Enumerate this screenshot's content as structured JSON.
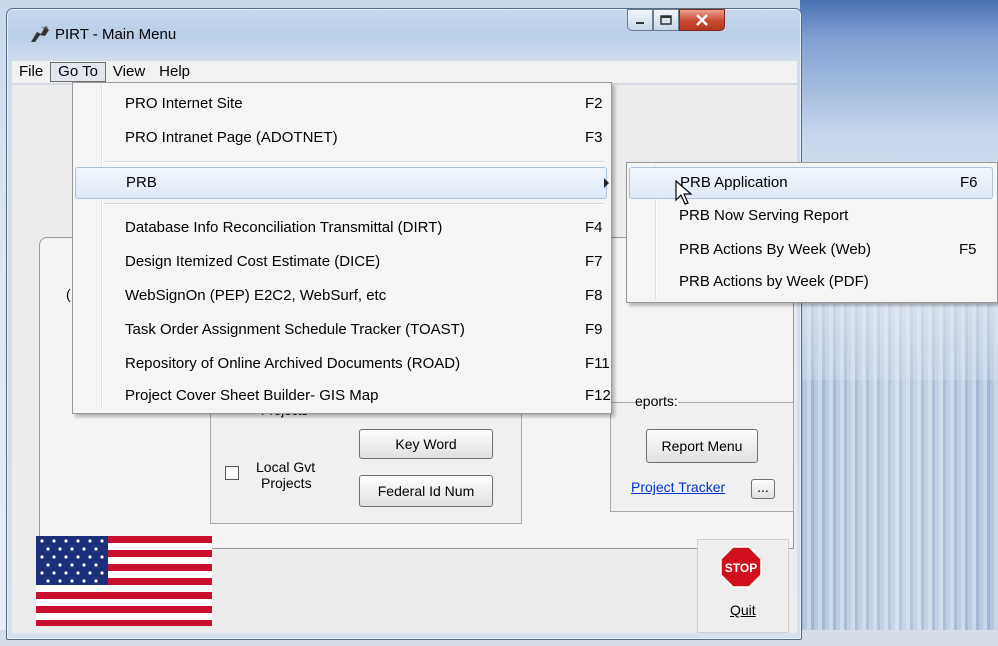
{
  "window": {
    "title": "PIRT - Main Menu",
    "icon": "pirt-app-icon"
  },
  "menubar": {
    "items": [
      "File",
      "Go To",
      "View",
      "Help"
    ],
    "active": "Go To"
  },
  "goto_menu": {
    "items": [
      {
        "label": "PRO Internet Site",
        "key": "F2"
      },
      {
        "label": "PRO Intranet Page (ADOTNET)",
        "key": "F3"
      },
      {
        "label": "PRB",
        "key": ""
      },
      {
        "label": "Database Info Reconciliation Transmittal (DIRT)",
        "key": "F4"
      },
      {
        "label": "Design Itemized Cost Estimate (DICE)",
        "key": "F7"
      },
      {
        "label": "WebSignOn (PEP) E2C2, WebSurf, etc",
        "key": "F8"
      },
      {
        "label": "Task Order Assignment Schedule Tracker (TOAST)",
        "key": "F9"
      },
      {
        "label": "Repository of Online Archived Documents (ROAD)",
        "key": "F11"
      },
      {
        "label": "Project Cover Sheet Builder- GIS Map",
        "key": "F12"
      }
    ]
  },
  "prb_submenu": {
    "items": [
      {
        "label": "PRB Application",
        "key": "F6"
      },
      {
        "label": "PRB Now Serving Report",
        "key": ""
      },
      {
        "label": "PRB Actions By Week (Web)",
        "key": "F5"
      },
      {
        "label": "PRB Actions by Week (PDF)",
        "key": ""
      }
    ]
  },
  "main": {
    "partial_left_text": "(",
    "projects_label_partial": "Projects",
    "local_gvt_label_line1": "Local Gvt",
    "local_gvt_label_line2": "Projects",
    "key_word_button": "Key Word",
    "federal_id_button": "Federal Id Num",
    "reports_label": "eports:",
    "report_menu_button": "Report Menu",
    "project_tracker_link": "Project Tracker",
    "ellipsis_button": "...",
    "quit_label": "Quit",
    "stop_sign_text": "STOP"
  }
}
